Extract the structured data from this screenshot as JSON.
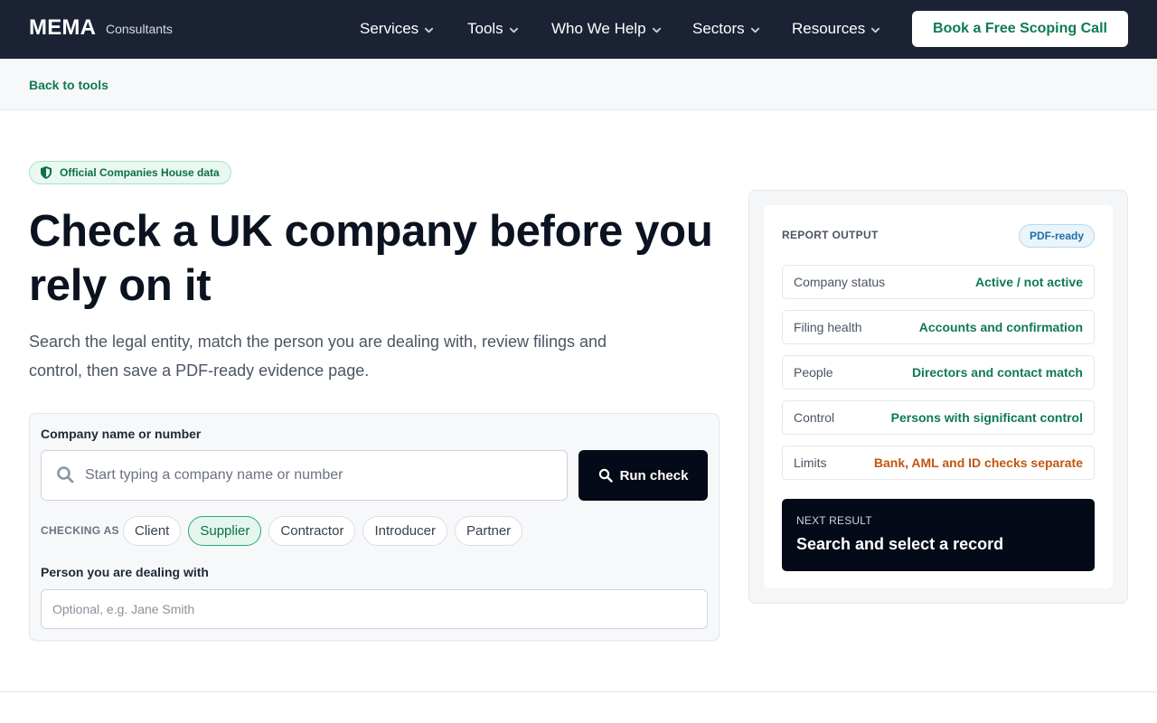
{
  "header": {
    "logo": "MEMA",
    "logo_sub": "Consultants",
    "nav": [
      "Services",
      "Tools",
      "Who We Help",
      "Sectors",
      "Resources"
    ],
    "cta": "Book a Free Scoping Call"
  },
  "subbar": {
    "back_link": "Back to tools"
  },
  "hero": {
    "badge": "Official Companies House data",
    "title": "Check a UK company before you rely on it",
    "text": "Search the legal entity, match the person you are dealing with, review filings and control, then save a PDF-ready evidence page."
  },
  "form": {
    "company_label": "Company name or number",
    "search_placeholder": "Start typing a company name or number",
    "run_button": "Run check",
    "checking_as_label": "CHECKING AS",
    "roles": [
      "Client",
      "Supplier",
      "Contractor",
      "Introducer",
      "Partner"
    ],
    "selected_role": "Supplier",
    "person_label": "Person you are dealing with",
    "person_placeholder": "Optional, e.g. Jane Smith"
  },
  "report": {
    "heading": "REPORT OUTPUT",
    "badge": "PDF-ready",
    "rows": [
      {
        "key": "Company status",
        "value": "Active / not active",
        "tone": "ok"
      },
      {
        "key": "Filing health",
        "value": "Accounts and confirmation",
        "tone": "ok"
      },
      {
        "key": "People",
        "value": "Directors and contact match",
        "tone": "ok"
      },
      {
        "key": "Control",
        "value": "Persons with significant control",
        "tone": "ok"
      },
      {
        "key": "Limits",
        "value": "Bank, AML and ID checks separate",
        "tone": "warn"
      }
    ],
    "next_label": "NEXT RESULT",
    "next_value": "Search and select a record"
  },
  "colors": {
    "header_bg": "#1b2234",
    "accent_green": "#0f7a52",
    "warning_orange": "#c2560c",
    "dark_button": "#050a18"
  }
}
